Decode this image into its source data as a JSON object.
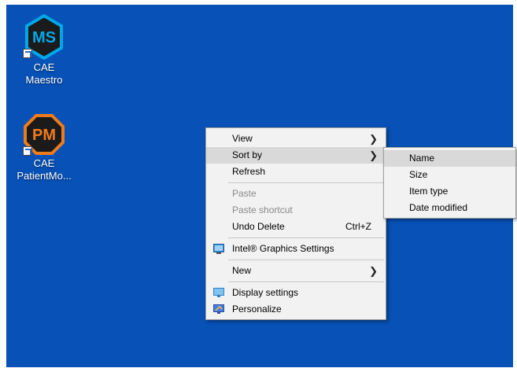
{
  "desktop": {
    "background": "#0751b7",
    "icons": [
      {
        "abbr": "MS",
        "label_lines": [
          "CAE Maestro"
        ],
        "color": "#00a8e8",
        "icon": "maestro-app-icon"
      },
      {
        "abbr": "PM",
        "label_lines": [
          "CAE",
          "PatientMo..."
        ],
        "color": "#f07b1a",
        "icon": "patient-monitor-app-icon"
      }
    ]
  },
  "context_menu": {
    "items": [
      {
        "label": "View",
        "submenu": true
      },
      {
        "label": "Sort by",
        "submenu": true,
        "highlighted": true
      },
      {
        "label": "Refresh"
      },
      {
        "label": "Paste",
        "disabled": true
      },
      {
        "label": "Paste shortcut",
        "disabled": true
      },
      {
        "label": "Undo Delete",
        "shortcut": "Ctrl+Z"
      },
      {
        "label": "Intel® Graphics Settings",
        "icon": "intel-graphics-icon"
      },
      {
        "label": "New",
        "submenu": true
      },
      {
        "label": "Display settings",
        "icon": "display-settings-icon"
      },
      {
        "label": "Personalize",
        "icon": "personalize-icon"
      }
    ]
  },
  "sort_submenu": {
    "items": [
      {
        "label": "Name",
        "highlighted": true
      },
      {
        "label": "Size"
      },
      {
        "label": "Item type"
      },
      {
        "label": "Date modified"
      }
    ]
  }
}
